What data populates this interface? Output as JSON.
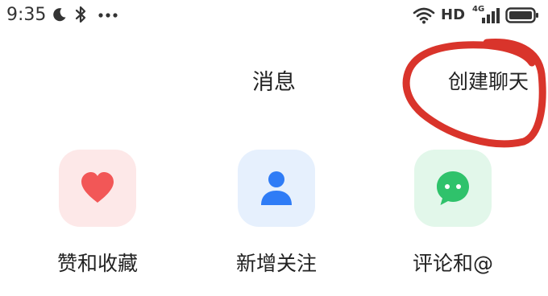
{
  "status_bar": {
    "time": "9:35",
    "icons": [
      "moon-icon",
      "bluetooth-icon",
      "more-dots-icon",
      "wifi-icon",
      "signal-icon",
      "battery-icon"
    ],
    "hd_label": "HD",
    "network_label": "4G"
  },
  "header": {
    "title": "消息",
    "create_chat_label": "创建聊天",
    "annotation_color": "#d9342b"
  },
  "shortcuts": [
    {
      "label": "赞和收藏",
      "icon": "heart-icon",
      "icon_color": "#f25757",
      "tile_color": "#fde8e8"
    },
    {
      "label": "新增关注",
      "icon": "person-icon",
      "icon_color": "#2f7cf6",
      "tile_color": "#e6f0fd"
    },
    {
      "label": "评论和@",
      "icon": "chat-bubble-icon",
      "icon_color": "#2fc26b",
      "tile_color": "#e2f7ea"
    }
  ]
}
